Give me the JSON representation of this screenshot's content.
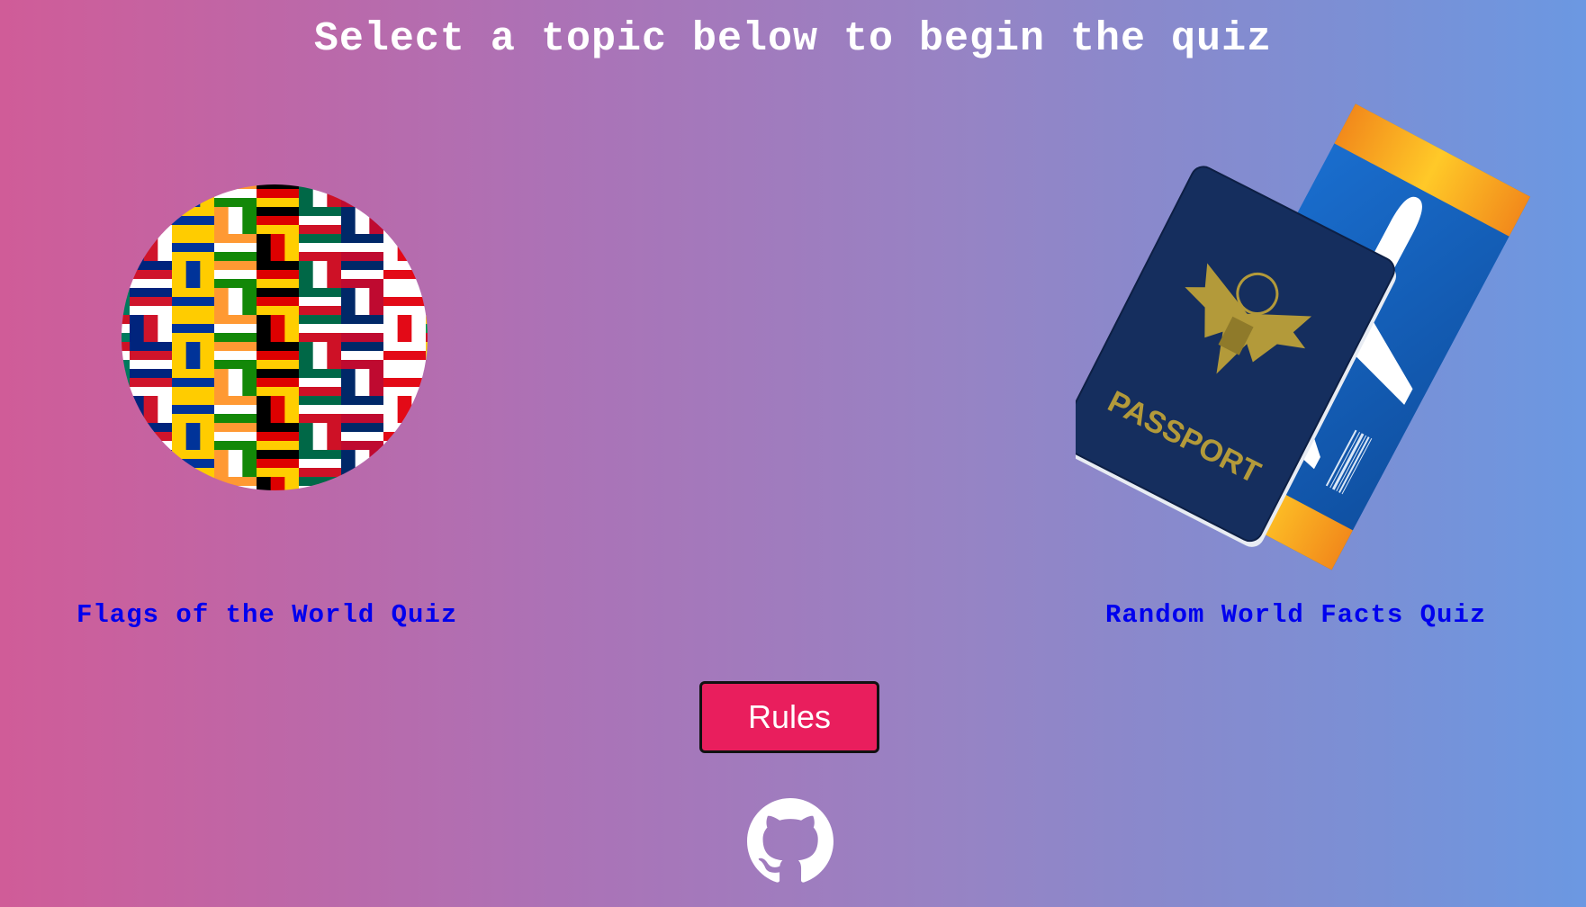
{
  "page": {
    "heading": "Select a topic below to begin the quiz"
  },
  "topics": [
    {
      "label": "Flags of the World Quiz",
      "image_icon": "flag-collage-virus-image"
    },
    {
      "label": "Random World Facts Quiz",
      "image_icon": "passport-ticket-image"
    }
  ],
  "rules_button": {
    "label": "Rules"
  },
  "footer": {
    "icon": "github-icon"
  },
  "colors": {
    "gradient_left": "#d05c98",
    "gradient_right": "#6b98e2",
    "link": "#0000ee",
    "rules_bg": "#e91e5d",
    "heading": "#ffffff"
  }
}
